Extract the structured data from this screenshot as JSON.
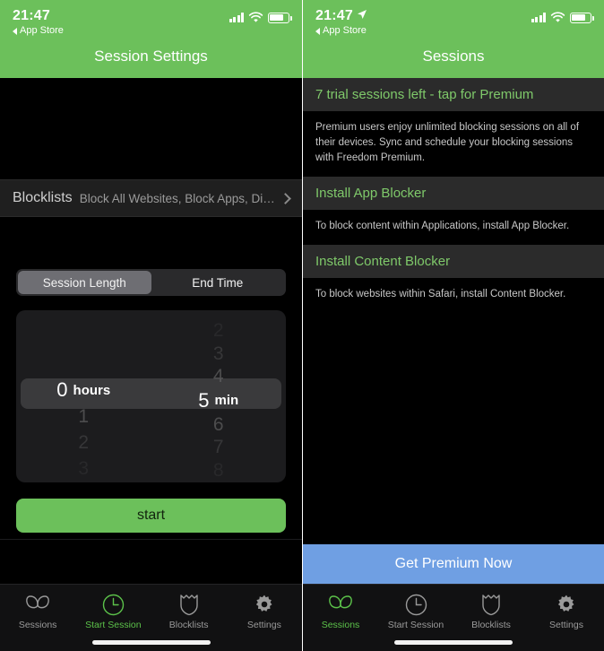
{
  "left": {
    "status": {
      "time": "21:47",
      "back_label": "App Store",
      "has_location_arrow": false
    },
    "nav_title": "Session Settings",
    "blocklists_row": {
      "title": "Blocklists",
      "subtitle": "Block All Websites, Block Apps, Distrac...",
      "chevron": "chevron-right-icon"
    },
    "segmented": {
      "options": [
        "Session Length",
        "End Time"
      ],
      "selected": "Session Length"
    },
    "picker": {
      "hours": {
        "above": [],
        "selected": "0",
        "unit": "hours",
        "below": [
          "1",
          "2",
          "3"
        ]
      },
      "minutes": {
        "above": [
          "2",
          "3",
          "4"
        ],
        "selected": "5",
        "unit": "min",
        "below": [
          "6",
          "7",
          "8"
        ]
      }
    },
    "start_button": "start",
    "tabs": [
      {
        "label": "Sessions",
        "icon": "butterfly-icon",
        "active": false
      },
      {
        "label": "Start Session",
        "icon": "clock-icon",
        "active": true
      },
      {
        "label": "Blocklists",
        "icon": "shield-icon",
        "active": false
      },
      {
        "label": "Settings",
        "icon": "gear-icon",
        "active": false
      }
    ]
  },
  "right": {
    "status": {
      "time": "21:47",
      "back_label": "App Store",
      "has_location_arrow": true
    },
    "nav_title": "Sessions",
    "sections": [
      {
        "heading": "7 trial sessions left - tap for Premium",
        "body": "Premium users enjoy unlimited blocking sessions on all of their devices. Sync and schedule your blocking sessions with Freedom Premium."
      },
      {
        "heading": "Install App Blocker",
        "body": "To block content within Applications, install App Blocker."
      },
      {
        "heading": "Install Content Blocker",
        "body": "To block websites within Safari, install Content Blocker."
      }
    ],
    "premium_button": "Get Premium Now",
    "tabs": [
      {
        "label": "Sessions",
        "icon": "butterfly-icon",
        "active": true
      },
      {
        "label": "Start Session",
        "icon": "clock-icon",
        "active": false
      },
      {
        "label": "Blocklists",
        "icon": "shield-icon",
        "active": false
      },
      {
        "label": "Settings",
        "icon": "gear-icon",
        "active": false
      }
    ]
  },
  "colors": {
    "green_header": "#6cc05b",
    "green_accent": "#5cc24a",
    "blue_button": "#6f9fe3",
    "screen_bg": "#000000"
  }
}
